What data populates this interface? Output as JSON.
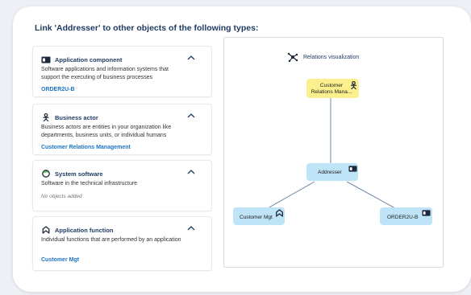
{
  "header": {
    "title": "Link 'Addresser' to other objects of the following types:"
  },
  "panels": [
    {
      "icon": "application-component-icon",
      "title": "Application component",
      "description": "Software applications and information systems that support the executing of business processes",
      "linked": "ORDER2U-B"
    },
    {
      "icon": "business-actor-icon",
      "title": "Business actor",
      "description": "Business actors are entities in your organization like departments, business units, or individual humans",
      "linked": "Customer Relations Management"
    },
    {
      "icon": "system-software-icon",
      "title": "System software",
      "description": "Software in the technical infrastructure",
      "empty": "No objects added"
    },
    {
      "icon": "application-function-icon",
      "title": "Application function",
      "description": "Individual functions that are performed by an application",
      "linked": "Customer Mgt"
    }
  ],
  "visualization": {
    "title": "Relations visualization",
    "nodes": {
      "actor": "Customer Relations Mana...",
      "center": "Addresser",
      "function": "Customer Mgt",
      "component": "ORDER2U-B"
    }
  },
  "colors": {
    "title": "#1f3b63",
    "link": "#1b74c4",
    "node_blue": "#bfe3f7",
    "node_yellow": "#fbef8e",
    "edge": "#6f8aa6"
  }
}
